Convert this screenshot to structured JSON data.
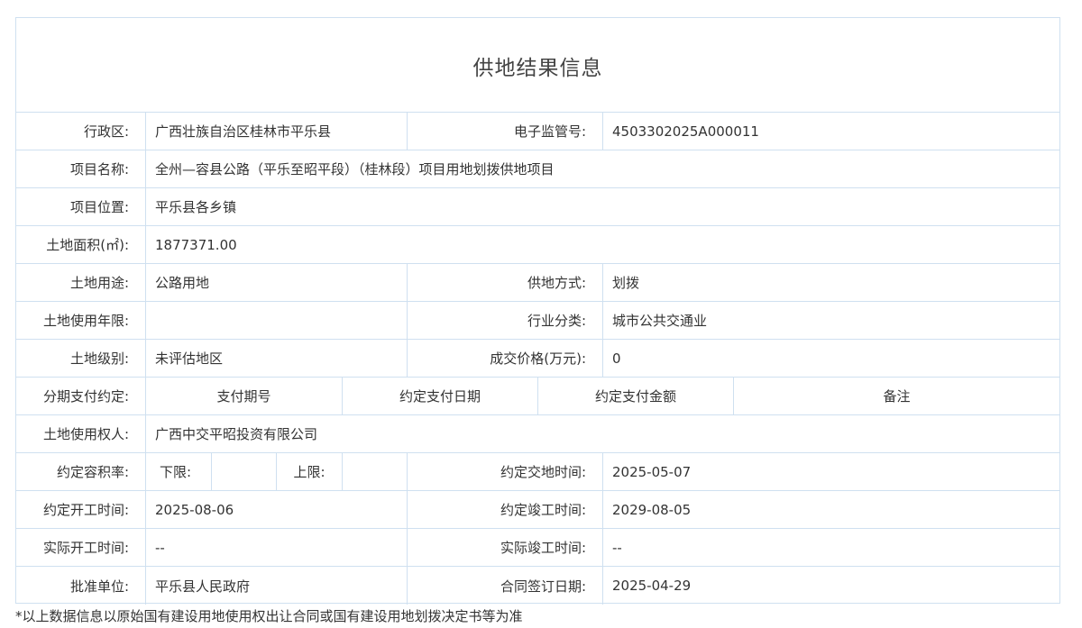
{
  "title": "供地结果信息",
  "rows": {
    "admin": {
      "label": "行政区:",
      "value": "广西壮族自治区桂林市平乐县",
      "label2": "电子监管号:",
      "value2": "4503302025A000011"
    },
    "project_name": {
      "label": "项目名称:",
      "value": "全州—容县公路（平乐至昭平段）（桂林段）项目用地划拨供地项目"
    },
    "project_location": {
      "label": "项目位置:",
      "value": "平乐县各乡镇"
    },
    "land_area": {
      "label": "土地面积(㎡):",
      "value": "1877371.00"
    },
    "land_use": {
      "label": "土地用途:",
      "value": "公路用地",
      "label2": "供地方式:",
      "value2": "划拨"
    },
    "use_years": {
      "label": "土地使用年限:",
      "value": "",
      "label2": "行业分类:",
      "value2": "城市公共交通业"
    },
    "land_grade": {
      "label": "土地级别:",
      "value": "未评估地区",
      "label2": "成交价格(万元):",
      "value2": "0"
    },
    "installment": {
      "label": "分期支付约定:",
      "headers": [
        "支付期号",
        "约定支付日期",
        "约定支付金额",
        "备注"
      ]
    },
    "right_holder": {
      "label": "土地使用权人:",
      "value": "广西中交平昭投资有限公司"
    },
    "plot_ratio": {
      "label": "约定容积率:",
      "lower_label": "下限:",
      "lower_value": "",
      "upper_label": "上限:",
      "upper_value": "",
      "label2": "约定交地时间:",
      "value2": "2025-05-07"
    },
    "planned_start": {
      "label": "约定开工时间:",
      "value": "2025-08-06",
      "label2": "约定竣工时间:",
      "value2": "2029-08-05"
    },
    "actual_start": {
      "label": "实际开工时间:",
      "value": "--",
      "label2": "实际竣工时间:",
      "value2": "--"
    },
    "approval": {
      "label": "批准单位:",
      "value": "平乐县人民政府",
      "label2": "合同签订日期:",
      "value2": "2025-04-29"
    }
  },
  "footnote": "*以上数据信息以原始国有建设用地使用权出让合同或国有建设用地划拨决定书等为准",
  "colors": {
    "border": "#cfe0f0",
    "text": "#333333",
    "title": "#444444"
  }
}
